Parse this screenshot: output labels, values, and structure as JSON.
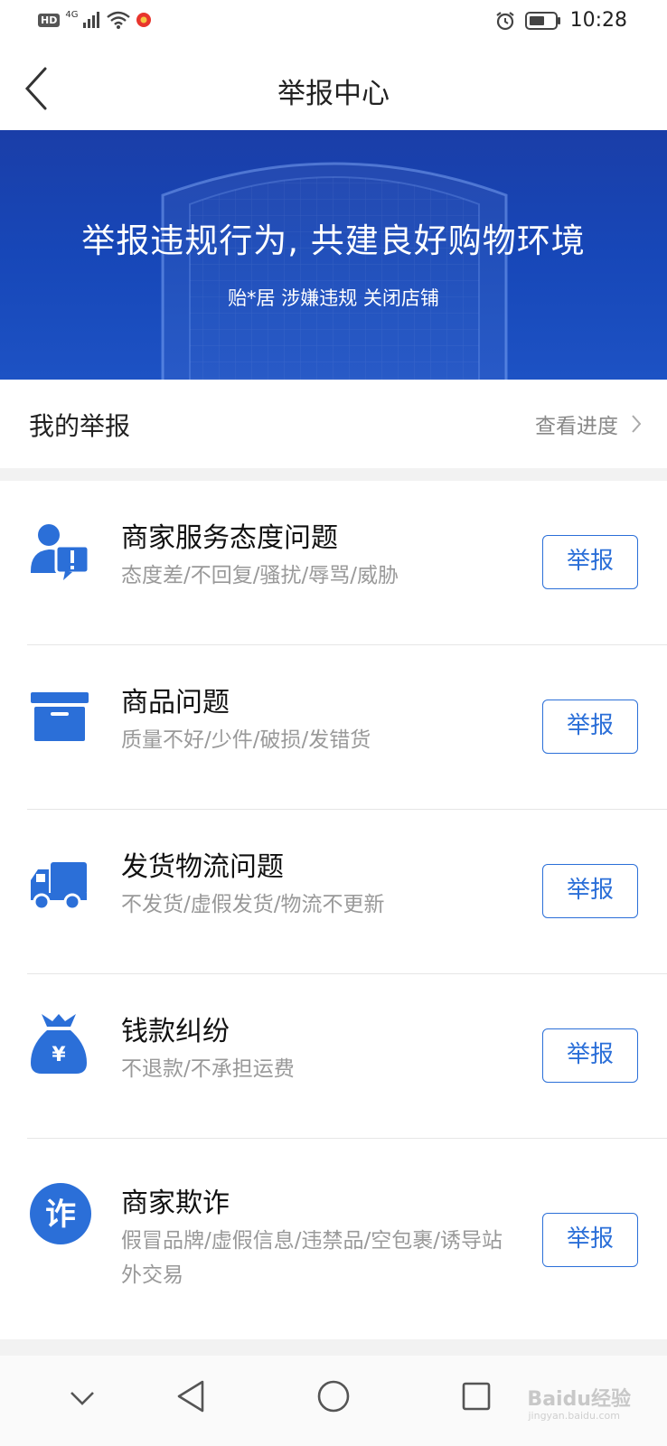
{
  "status_bar": {
    "hd": "HD",
    "network": "4G",
    "time": "10:28"
  },
  "nav": {
    "title": "举报中心"
  },
  "banner": {
    "title": "举报违规行为, 共建良好购物环境",
    "subtitle": "贻*居 涉嫌违规 关闭店铺"
  },
  "my_report": {
    "label": "我的举报",
    "link": "查看进度"
  },
  "categories": [
    {
      "title": "商家服务态度问题",
      "desc": "态度差/不回复/骚扰/辱骂/威胁",
      "button": "举报",
      "icon": "service-attitude-icon"
    },
    {
      "title": "商品问题",
      "desc": "质量不好/少件/破损/发错货",
      "button": "举报",
      "icon": "product-box-icon"
    },
    {
      "title": "发货物流问题",
      "desc": "不发货/虚假发货/物流不更新",
      "button": "举报",
      "icon": "truck-icon"
    },
    {
      "title": "钱款纠纷",
      "desc": "不退款/不承担运费",
      "button": "举报",
      "icon": "money-bag-icon"
    },
    {
      "title": "商家欺诈",
      "desc": "假冒品牌/虚假信息/违禁品/空包裹/诱导站外交易",
      "button": "举报",
      "icon": "fraud-icon",
      "icon_text": "诈"
    }
  ],
  "watermark": {
    "text": "Baidu经验",
    "sub": "jingyan.baidu.com"
  },
  "colors": {
    "accent": "#2b6fd8",
    "banner": "#1747b8"
  }
}
